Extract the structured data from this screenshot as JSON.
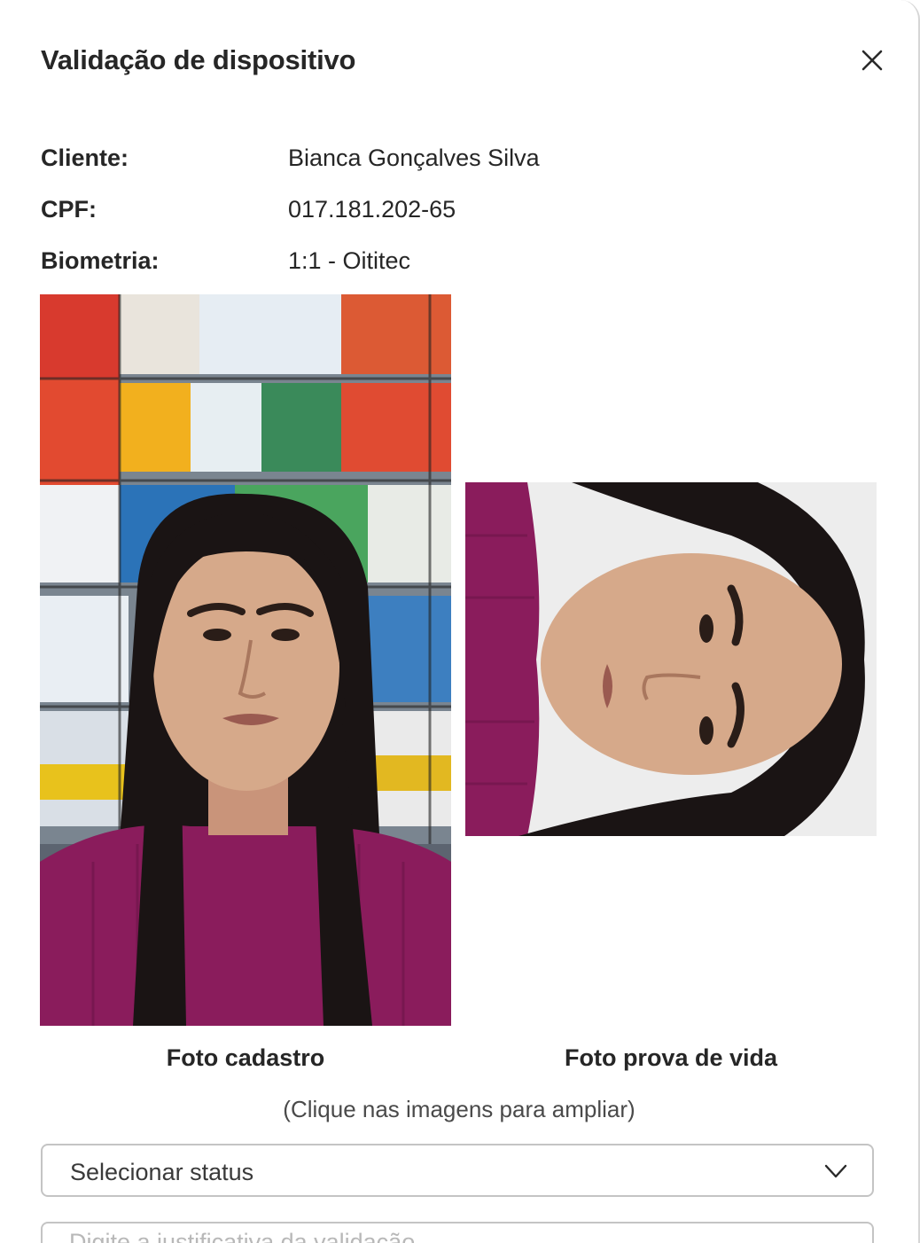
{
  "modal": {
    "title": "Validação de dispositivo",
    "close_icon": "close-icon"
  },
  "client_info": [
    {
      "label": "Cliente:",
      "value": "Bianca Gonçalves Silva"
    },
    {
      "label": "CPF:",
      "value": "017.181.202-65"
    },
    {
      "label": "Biometria:",
      "value": "1:1 - Oititec"
    }
  ],
  "photos": {
    "registration": {
      "caption": "Foto cadastro",
      "icon": "registration-photo"
    },
    "liveness": {
      "caption": "Foto prova de vida",
      "icon": "liveness-photo"
    },
    "hint": "(Clique nas imagens para ampliar)"
  },
  "status_select": {
    "selected": "Selecionar status",
    "icon": "chevron-down-icon"
  },
  "justification": {
    "placeholder": "Digite a justificativa da validação"
  },
  "colors": {
    "sweater": "#8a1c5c",
    "hair": "#1a1414",
    "skin": "#d6a98a",
    "border": "#c4c4c4"
  }
}
